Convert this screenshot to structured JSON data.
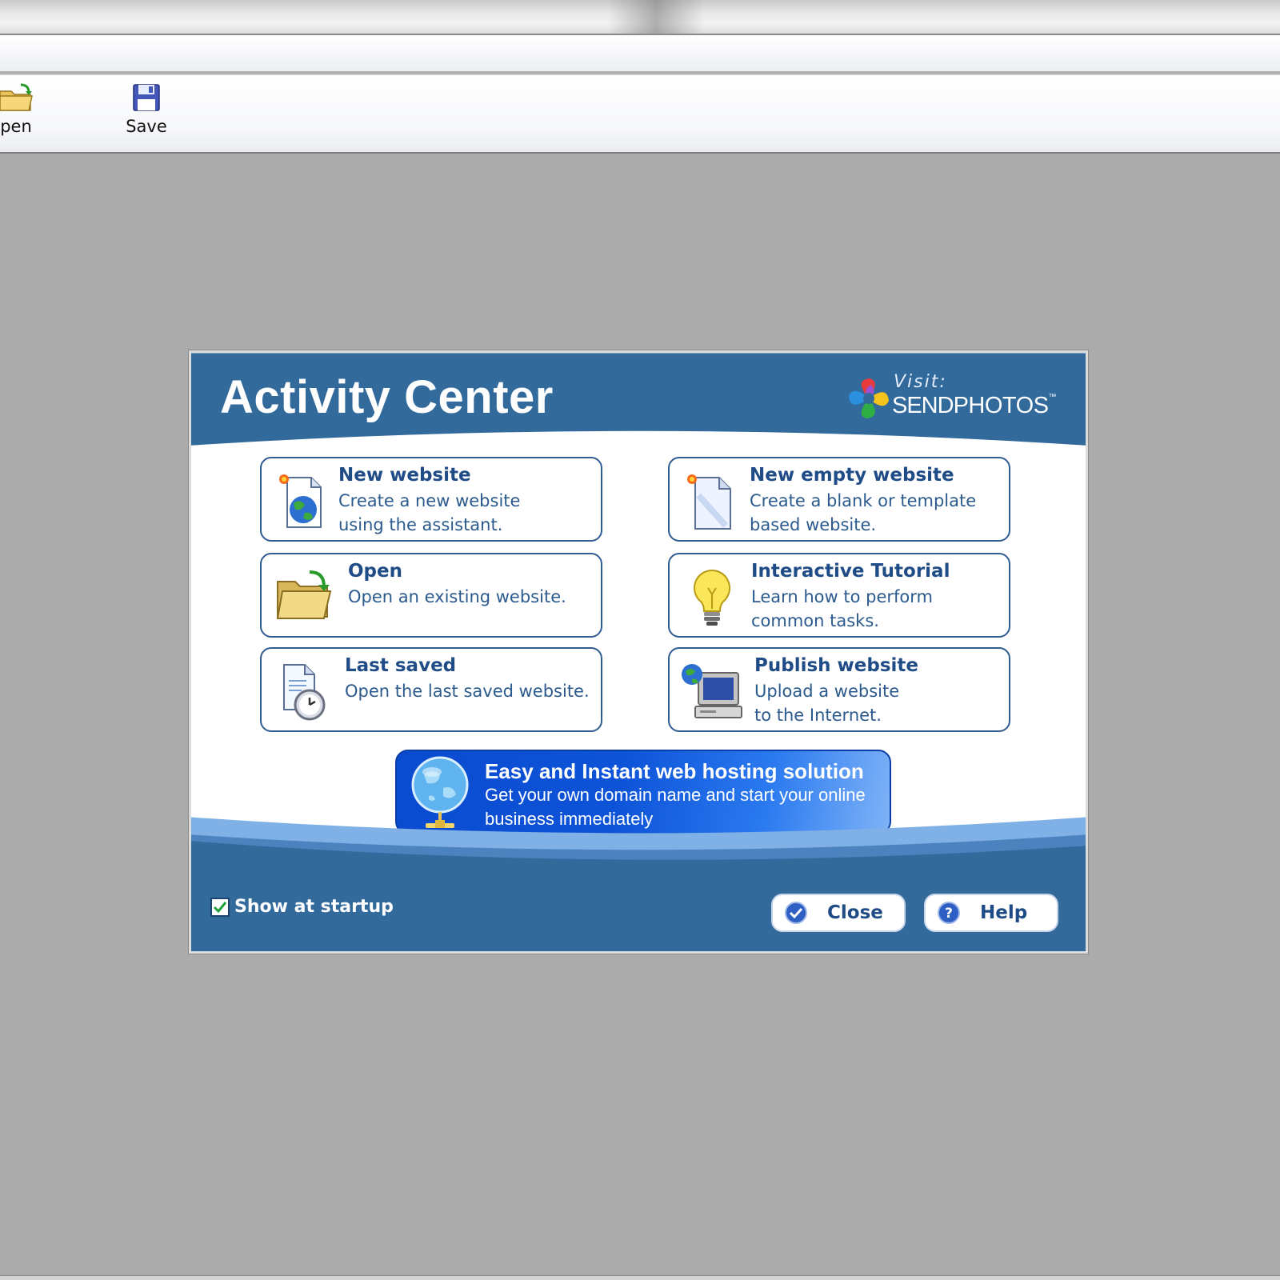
{
  "toolbar": {
    "open_label": "pen",
    "save_label": "Save"
  },
  "dialog": {
    "title": "Activity Center",
    "logo": {
      "visit": "Visit:",
      "brand_bold": "SEND",
      "brand_rest": "PHOTOS",
      "trademark": "™"
    },
    "tiles": [
      {
        "title": "New website",
        "desc": "Create a new website\nusing the assistant.",
        "icon": "new-website-icon"
      },
      {
        "title": "New empty website",
        "desc": "Create a blank or template\nbased website.",
        "icon": "new-document-icon"
      },
      {
        "title": "Open",
        "desc": "Open an existing website.",
        "icon": "open-folder-icon"
      },
      {
        "title": "Interactive Tutorial",
        "desc": "Learn how to perform\ncommon tasks.",
        "icon": "lightbulb-icon"
      },
      {
        "title": "Last saved",
        "desc": "Open the last saved website.",
        "icon": "document-clock-icon"
      },
      {
        "title": "Publish website",
        "desc": "Upload a website\nto the Internet.",
        "icon": "computer-globe-icon"
      }
    ],
    "banner": {
      "title": "Easy and Instant web hosting solution",
      "desc": "Get your own domain name and start your online\nbusiness immediately",
      "icon": "network-globe-icon"
    },
    "footer": {
      "show_at_startup_label": "Show at startup",
      "show_at_startup_checked": true,
      "close_label": "Close",
      "help_label": "Help"
    }
  },
  "colors": {
    "dialog_blue": "#326a9c",
    "title_text": "#1f4c86",
    "banner_blue": "#0d53d8",
    "workspace": "#ababab"
  }
}
